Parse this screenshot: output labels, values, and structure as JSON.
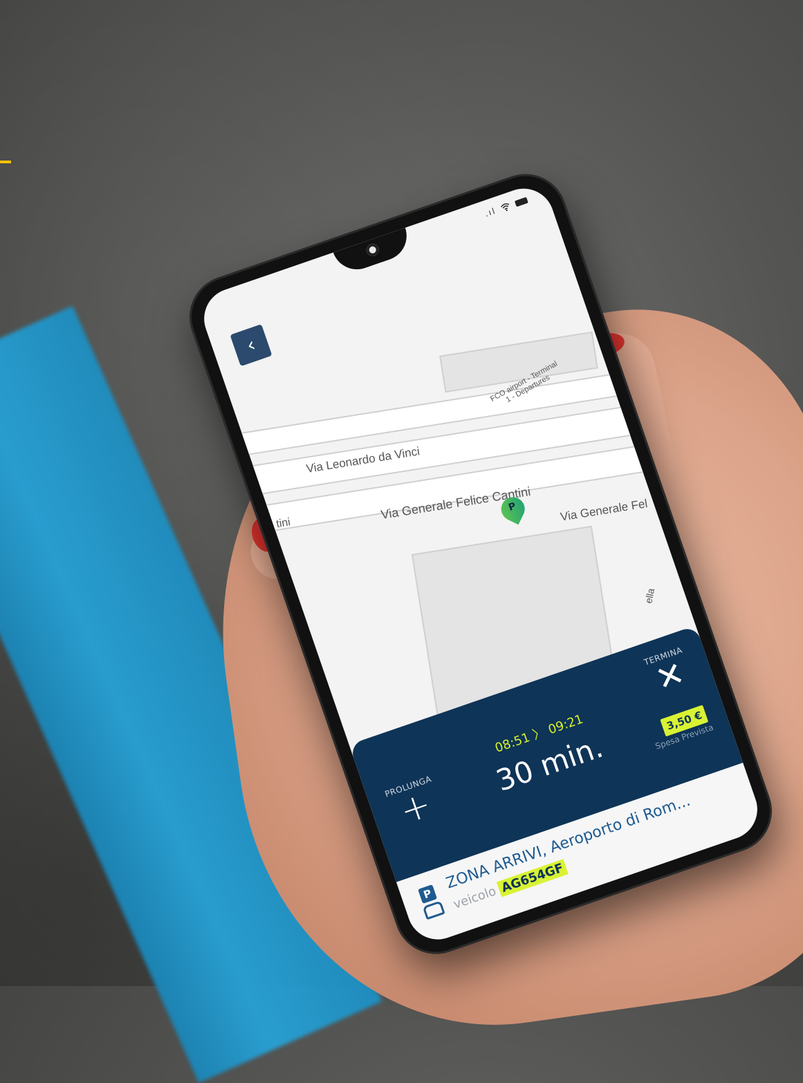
{
  "scene": {
    "background": "#555553",
    "stripe_color": "#27a2d6",
    "nail_color": "#e0342f"
  },
  "status_bar": {
    "signal": ".ıl",
    "wifi_icon": "wifi-icon",
    "battery_icon": "battery-icon"
  },
  "nav": {
    "back_glyph": "‹"
  },
  "map": {
    "labels": [
      "Via Leonardo da Vinci",
      "FCO airport - Terminal 1 - Departures",
      "tini",
      "Via Generale Felice Cantini",
      "Via Generale Fel",
      "ella"
    ],
    "marker_letter": "P",
    "marker_color": "#1a9e7b"
  },
  "session": {
    "extend_label": "PROLUNGA",
    "extend_glyph": "+",
    "start_time": "08:51",
    "separator": "〉",
    "end_time": "09:21",
    "duration": "30 min.",
    "end_label": "TERMINA",
    "end_glyph": "✕",
    "price": "3,50 €",
    "price_caption": "Spesa Prevista",
    "panel_color": "#0e3457",
    "highlight_color": "#d9f233"
  },
  "parking": {
    "badge_letter": "P",
    "zone": "ZONA ARRIVI, Aeroporto di Rom...",
    "vehicle_label": "veicolo",
    "plate": "AG654GF"
  }
}
